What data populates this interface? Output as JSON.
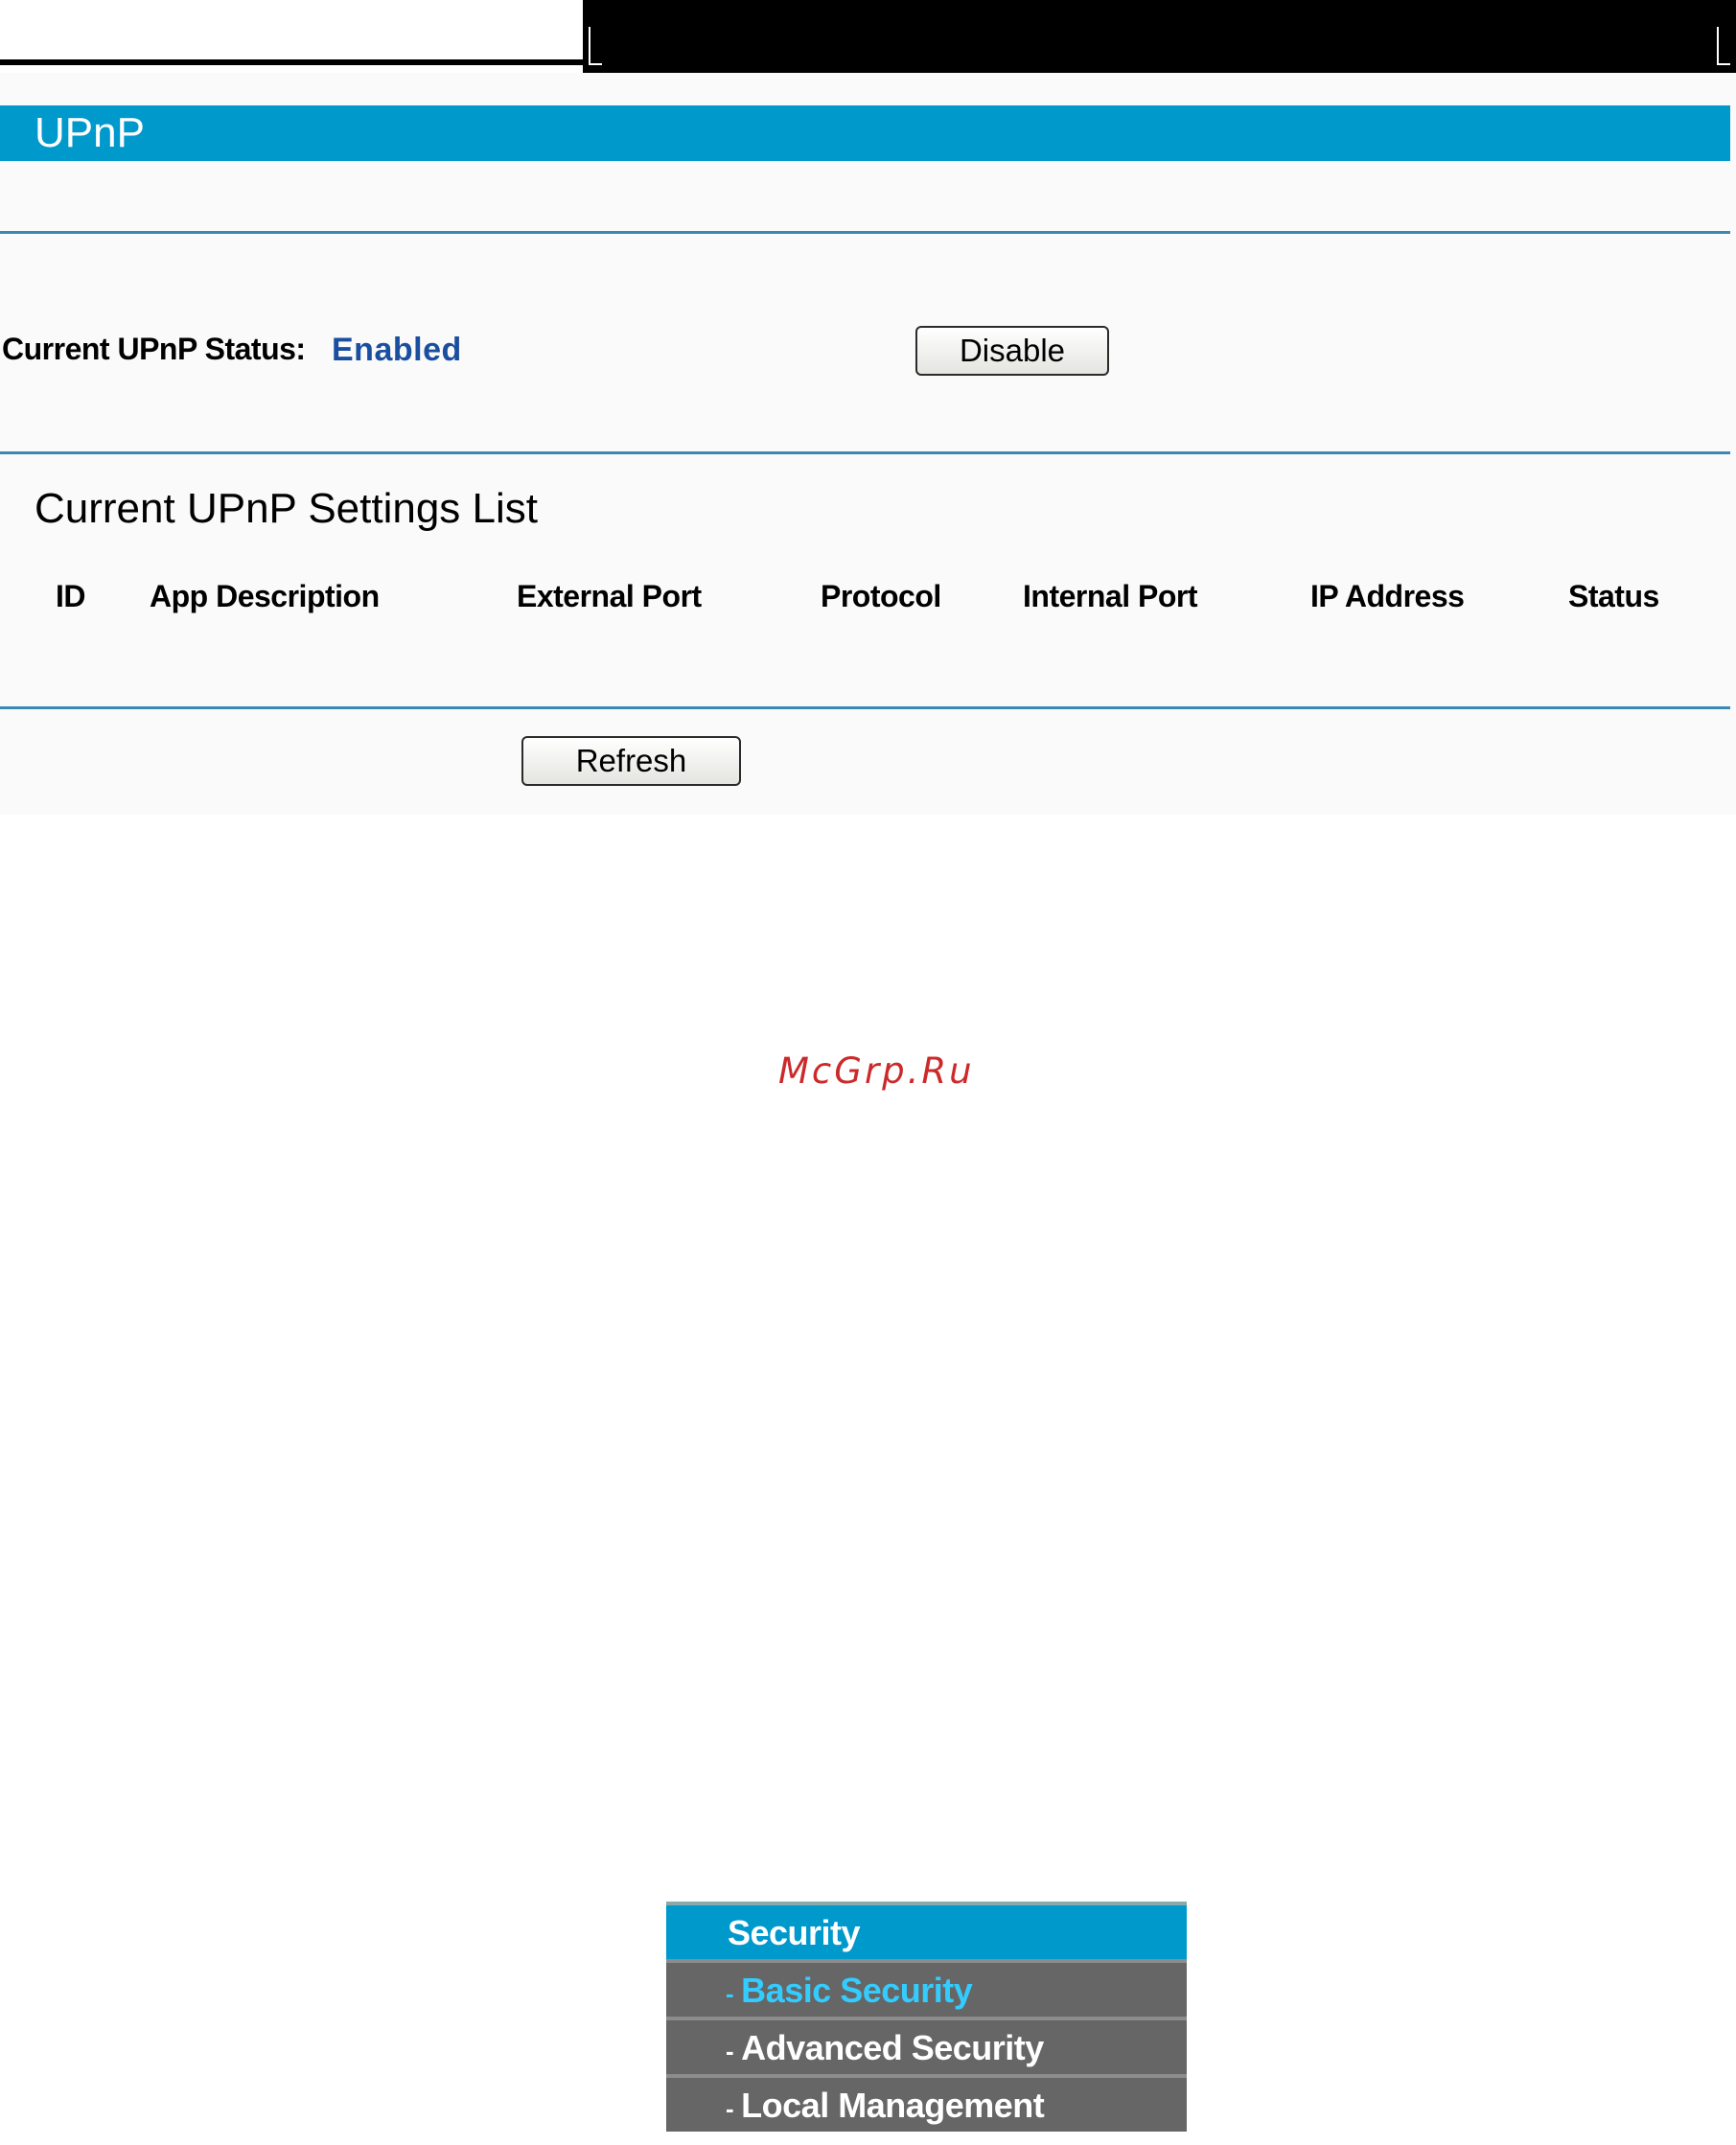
{
  "upnp": {
    "title": "UPnP",
    "status_label": "Current UPnP Status:",
    "status_value": "Enabled",
    "disable_button": "Disable",
    "settings_title": "Current UPnP Settings List",
    "columns": [
      "ID",
      "App Description",
      "External Port",
      "Protocol",
      "Internal Port",
      "IP Address",
      "Status"
    ],
    "refresh_button": "Refresh"
  },
  "watermark": "McGrp.Ru",
  "menu": {
    "header": "Security",
    "items": [
      {
        "dash": "-",
        "label": "Basic Security",
        "active": true
      },
      {
        "dash": "-",
        "label": "Advanced Security",
        "active": false
      },
      {
        "dash": "-",
        "label": "Local Management",
        "active": false
      }
    ]
  },
  "colors": {
    "accent": "#0099cc",
    "status_text": "#1a4fa0",
    "active_menu_text": "#33ccff",
    "menu_item_bg": "#666666"
  }
}
